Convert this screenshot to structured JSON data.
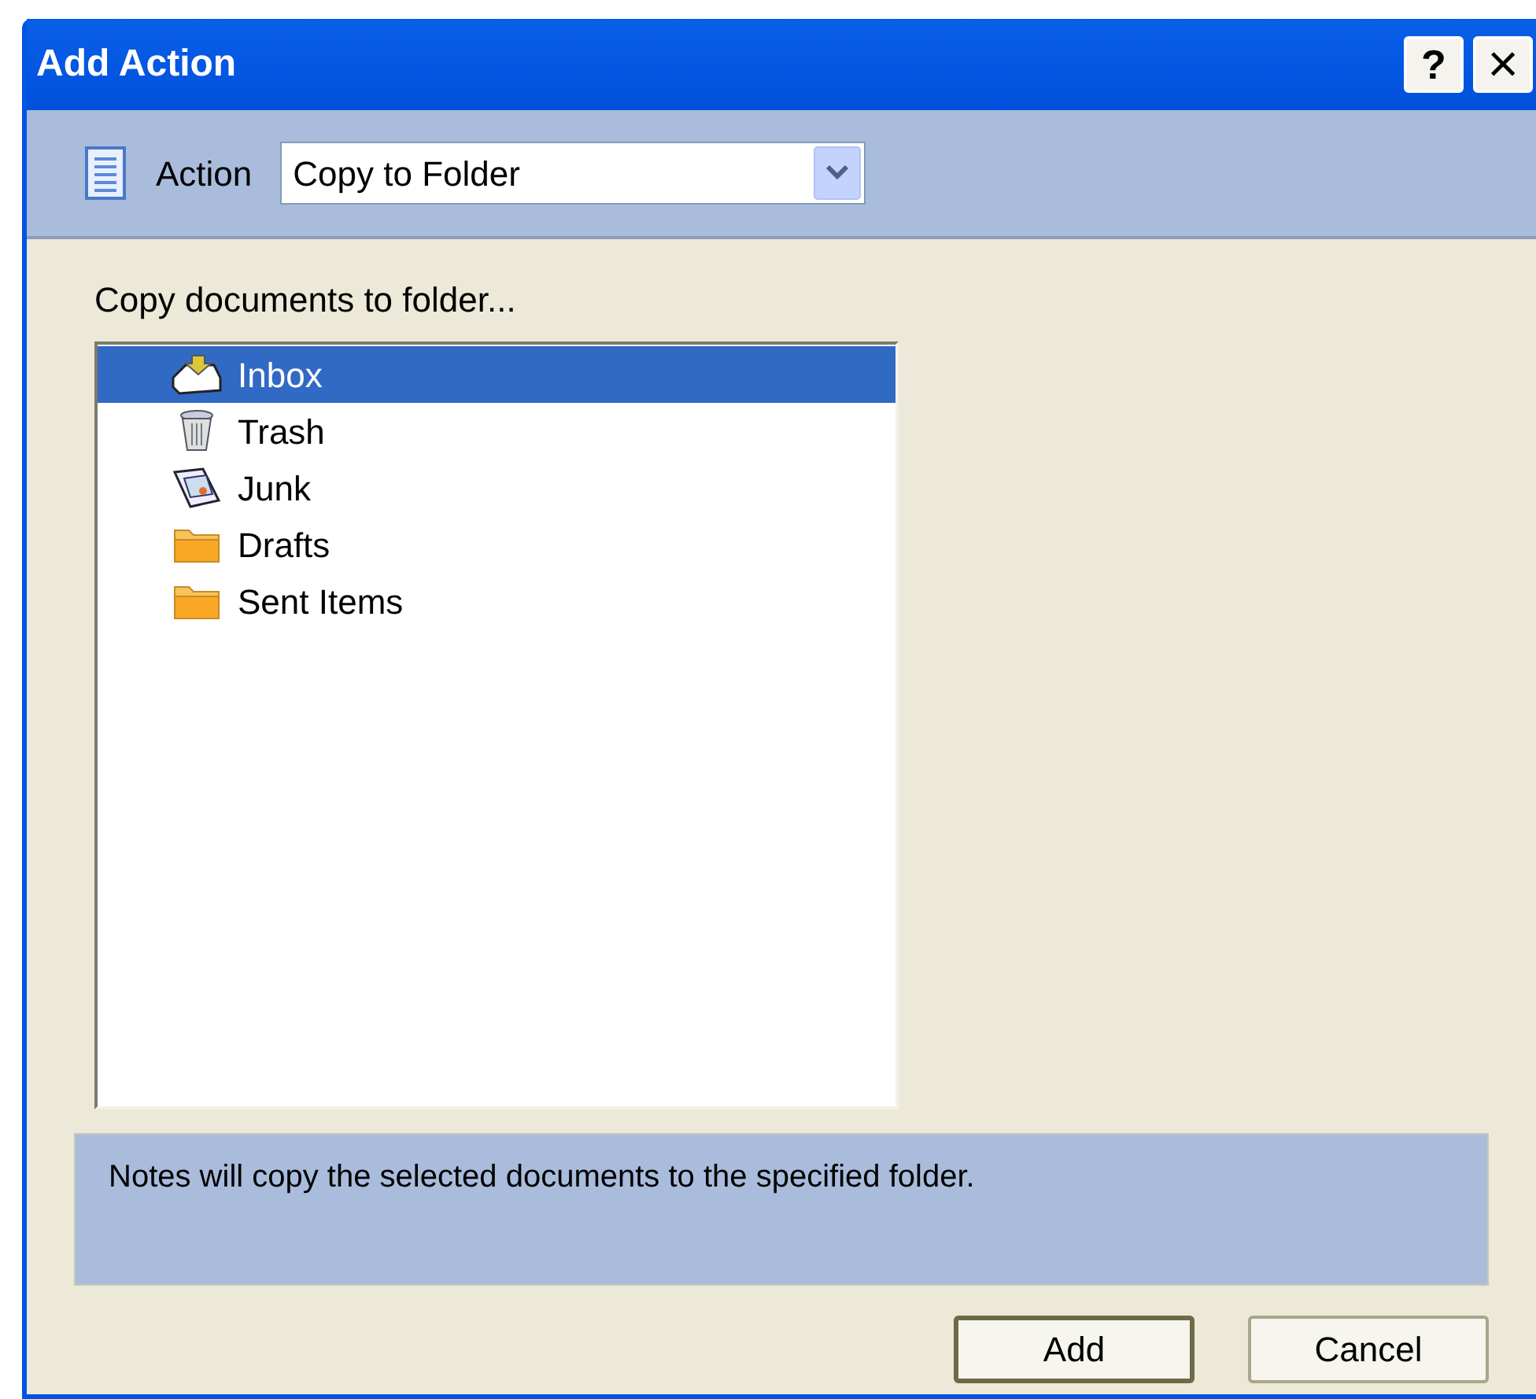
{
  "window": {
    "title": "Add Action",
    "help_button": "?",
    "close_button": "×"
  },
  "action": {
    "label": "Action",
    "value": "Copy to Folder"
  },
  "folder_list": {
    "label": "Copy documents to folder...",
    "items": [
      {
        "label": "Inbox",
        "kind": "inbox",
        "selected": true
      },
      {
        "label": "Trash",
        "kind": "trash",
        "selected": false
      },
      {
        "label": "Junk",
        "kind": "junk",
        "selected": false
      },
      {
        "label": "Drafts",
        "kind": "folder",
        "selected": false
      },
      {
        "label": "Sent Items",
        "kind": "folder",
        "selected": false
      }
    ]
  },
  "description": "Notes will copy the selected documents to the specified folder.",
  "buttons": [
    {
      "label": "Add",
      "default": true
    },
    {
      "label": "Cancel",
      "default": false
    }
  ]
}
